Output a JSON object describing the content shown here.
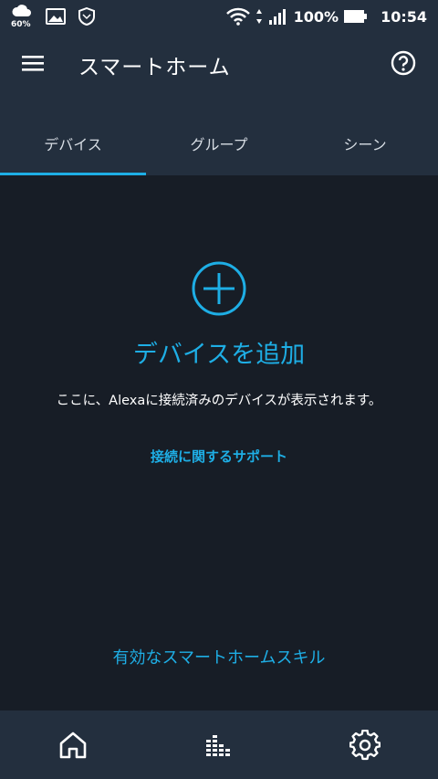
{
  "status_bar": {
    "weather_pct": "60%",
    "battery": "100%",
    "time": "10:54"
  },
  "app_bar": {
    "title": "スマートホーム"
  },
  "tabs": [
    {
      "label": "デバイス",
      "active": true
    },
    {
      "label": "グループ",
      "active": false
    },
    {
      "label": "シーン",
      "active": false
    }
  ],
  "main": {
    "add_title": "デバイスを追加",
    "description": "ここに、Alexaに接続済みのデバイスが表示されます。",
    "support_link": "接続に関するサポート",
    "skills_link": "有効なスマートホームスキル"
  },
  "colors": {
    "accent": "#1eaee5",
    "bar_bg": "#232f3e",
    "page_bg": "#171d26"
  },
  "icons": {
    "menu": "hamburger-icon",
    "help": "help-icon",
    "add": "plus-circle-icon",
    "home": "home-icon",
    "activity": "equalizer-icon",
    "settings": "gear-icon"
  }
}
